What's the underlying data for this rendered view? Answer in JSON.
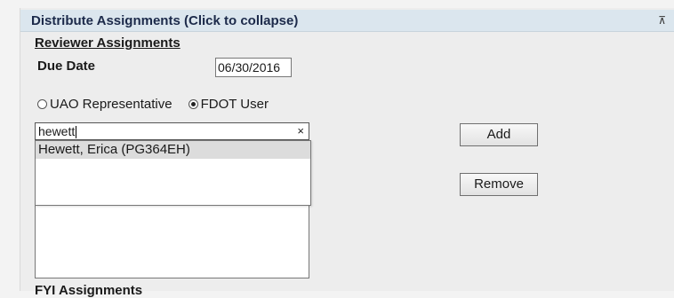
{
  "header": {
    "title": "Distribute Assignments",
    "hint": "(Click to collapse)",
    "collapse_icon": "collapse-up-icon"
  },
  "reviewer": {
    "section_title": "Reviewer Assignments",
    "due_date_label": "Due Date",
    "due_date_value": "06/30/2016",
    "radios": [
      {
        "label": "UAO Representative",
        "checked": false
      },
      {
        "label": "FDOT User",
        "checked": true
      }
    ],
    "search_value": "hewett",
    "clear_glyph": "×",
    "suggestions": [
      "Hewett, Erica (PG364EH)"
    ],
    "add_label": "Add",
    "remove_label": "Remove"
  },
  "fyi": {
    "section_title": "FYI Assignments"
  }
}
